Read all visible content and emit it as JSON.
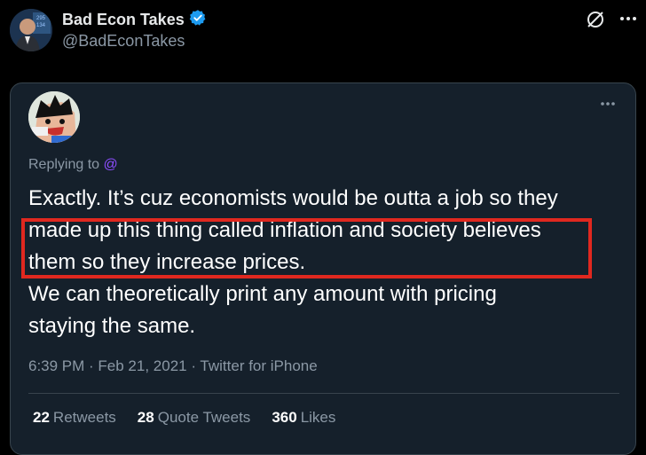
{
  "author": {
    "name": "Bad Econ Takes",
    "handle": "@BadEconTakes",
    "verified": true
  },
  "colors": {
    "background": "#000000",
    "card_background": "#15202b",
    "verified_blue": "#1d9bf0",
    "highlight_red": "#e0281f",
    "mention_purple": "#8d4dff"
  },
  "quoted_tweet": {
    "replying_prefix": "Replying to",
    "replying_mention": "@",
    "text_lines": [
      "Exactly. It’s cuz economists would be outta a job so they",
      "made up this thing called inflation and society believes",
      "them so they increase prices.",
      "We can theoretically print any amount with pricing",
      "staying the same."
    ],
    "timestamp": "6:39 PM · Feb 21, 2021",
    "source": "Twitter for iPhone",
    "stats": {
      "retweets_count": "22",
      "retweets_label": "Retweets",
      "quotes_count": "28",
      "quotes_label": "Quote Tweets",
      "likes_count": "360",
      "likes_label": "Likes"
    }
  },
  "icons": [
    "verified-badge-icon",
    "twitter-blocked-logo-icon",
    "more-options-icon"
  ]
}
